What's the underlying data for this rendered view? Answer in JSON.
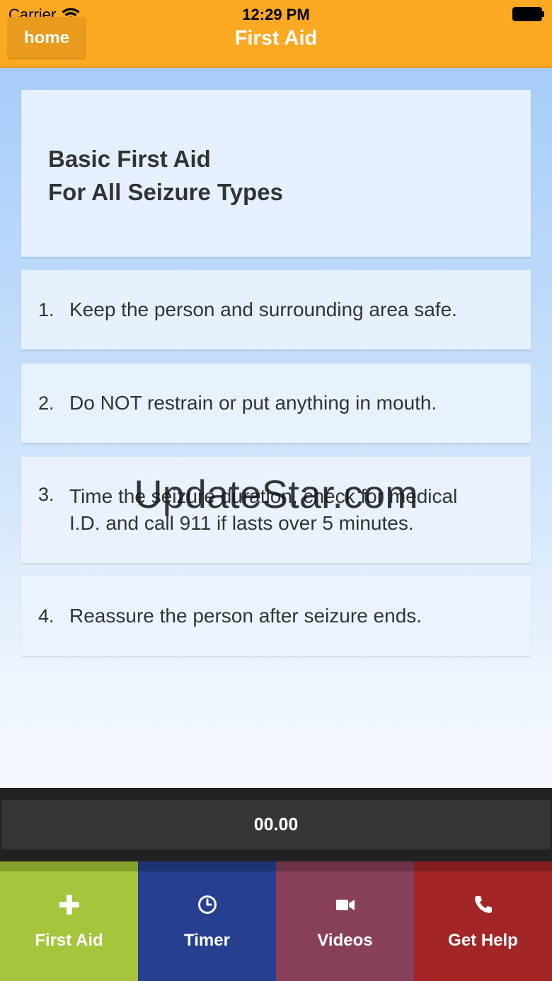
{
  "status_bar": {
    "carrier": "Carrier",
    "time": "12:29 PM"
  },
  "nav": {
    "home_label": "home",
    "title": "First Aid"
  },
  "title_card": {
    "line1": "Basic First Aid",
    "line2": "For All Seizure Types"
  },
  "steps": [
    {
      "num": "1.",
      "text": "Keep the person and surrounding area safe."
    },
    {
      "num": "2.",
      "text": "Do NOT restrain or put anything in mouth."
    },
    {
      "num": "3.",
      "line1": "Time the seizure duration, check for medical",
      "line2": "I.D. and call 911 if lasts over 5 minutes."
    },
    {
      "num": "4.",
      "text": "Reassure the person after seizure ends."
    }
  ],
  "watermark": "UpdateStar.com",
  "timer": {
    "value": "00.00"
  },
  "tabs": [
    {
      "label": "First Aid",
      "icon": "plus-icon",
      "color": "#a6c43c"
    },
    {
      "label": "Timer",
      "icon": "clock-icon",
      "color": "#26408f"
    },
    {
      "label": "Videos",
      "icon": "video-camera-icon",
      "color": "#88405a"
    },
    {
      "label": "Get Help",
      "icon": "phone-icon",
      "color": "#a22626"
    }
  ]
}
